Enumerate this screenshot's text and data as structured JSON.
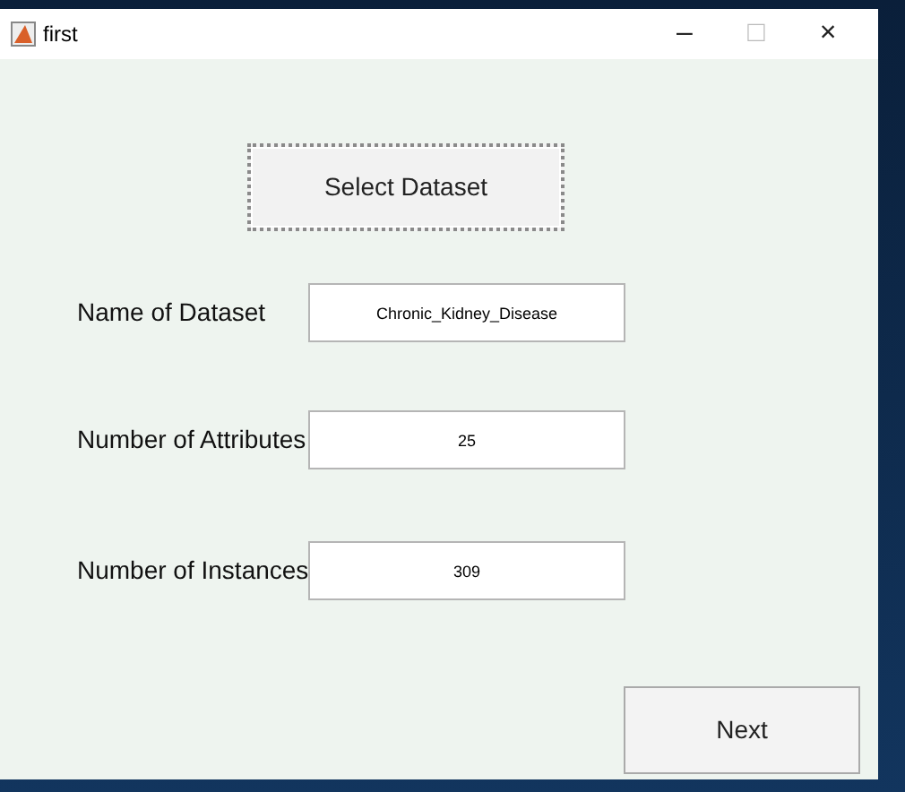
{
  "window": {
    "title": "first",
    "controls": [
      "–",
      "□",
      "×"
    ]
  },
  "select_button": "Select Dataset",
  "fields": [
    {
      "label": "Name of Dataset",
      "value": "Chronic_Kidney_Disease"
    },
    {
      "label": "Number of Attributes",
      "value": "25"
    },
    {
      "label": "Number of Instances",
      "value": "309"
    }
  ],
  "next_button": "Next"
}
